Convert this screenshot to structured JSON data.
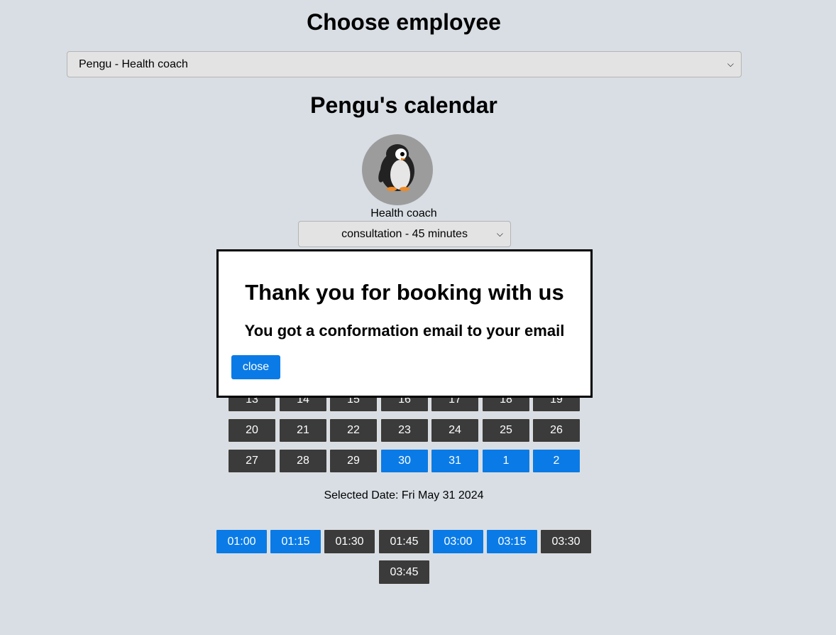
{
  "header": {
    "title": "Choose employee"
  },
  "employee_select": {
    "value": "Pengu - Health coach"
  },
  "calendar": {
    "title": "Pengu's calendar",
    "role": "Health coach",
    "service_select": {
      "value": "consultation - 45 minutes"
    },
    "day_rows": [
      [
        {
          "label": "13",
          "available": false
        },
        {
          "label": "14",
          "available": false
        },
        {
          "label": "15",
          "available": false
        },
        {
          "label": "16",
          "available": false
        },
        {
          "label": "17",
          "available": false
        },
        {
          "label": "18",
          "available": false
        },
        {
          "label": "19",
          "available": false
        }
      ],
      [
        {
          "label": "20",
          "available": false
        },
        {
          "label": "21",
          "available": false
        },
        {
          "label": "22",
          "available": false
        },
        {
          "label": "23",
          "available": false
        },
        {
          "label": "24",
          "available": false
        },
        {
          "label": "25",
          "available": false
        },
        {
          "label": "26",
          "available": false
        }
      ],
      [
        {
          "label": "27",
          "available": false
        },
        {
          "label": "28",
          "available": false
        },
        {
          "label": "29",
          "available": false
        },
        {
          "label": "30",
          "available": true
        },
        {
          "label": "31",
          "available": true
        },
        {
          "label": "1",
          "available": true
        },
        {
          "label": "2",
          "available": true
        }
      ]
    ],
    "selected_date": "Selected Date: Fri May 31 2024",
    "slots": [
      {
        "label": "01:00",
        "available": true
      },
      {
        "label": "01:15",
        "available": true
      },
      {
        "label": "01:30",
        "available": false
      },
      {
        "label": "01:45",
        "available": false
      },
      {
        "label": "03:00",
        "available": true
      },
      {
        "label": "03:15",
        "available": true
      },
      {
        "label": "03:30",
        "available": false
      },
      {
        "label": "03:45",
        "available": false
      }
    ]
  },
  "modal": {
    "heading": "Thank you for booking with us",
    "subheading": "You got a conformation email to your email",
    "close_label": "close"
  },
  "colors": {
    "available": "#0a7be6",
    "unavailable": "#3b3b3b",
    "background": "#d8dee4"
  },
  "icons": {
    "avatar": "penguin-icon",
    "select_arrow": "chevron-down-icon"
  }
}
